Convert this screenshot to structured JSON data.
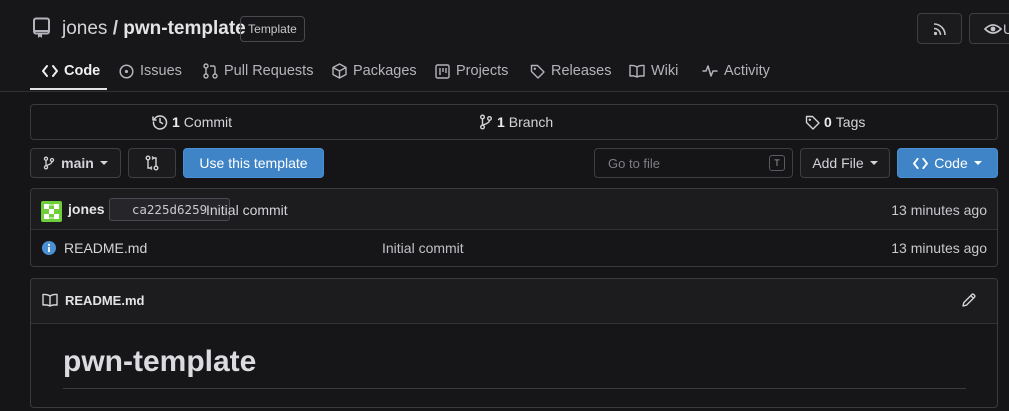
{
  "repo": {
    "owner": "jones",
    "separator": "/",
    "name": "pwn-template",
    "badge": "Template"
  },
  "header_actions": {
    "rss_icon": "rss-icon",
    "watch_icon": "eye-icon",
    "watch_label_partial": "U"
  },
  "tabs": [
    {
      "label": "Code",
      "icon": "code-icon",
      "active": true
    },
    {
      "label": "Issues",
      "icon": "issue-icon"
    },
    {
      "label": "Pull Requests",
      "icon": "pull-request-icon"
    },
    {
      "label": "Packages",
      "icon": "package-icon"
    },
    {
      "label": "Projects",
      "icon": "project-icon"
    },
    {
      "label": "Releases",
      "icon": "tag-icon"
    },
    {
      "label": "Wiki",
      "icon": "book-icon"
    },
    {
      "label": "Activity",
      "icon": "pulse-icon"
    }
  ],
  "stats": {
    "commits_count": "1",
    "commits_label": "Commit",
    "branches_count": "1",
    "branches_label": "Branch",
    "tags_count": "0",
    "tags_label": "Tags"
  },
  "toolbar": {
    "branch": "main",
    "use_template_label": "Use this template",
    "goto_placeholder": "Go to file",
    "goto_shortcut": "T",
    "add_file_label": "Add File",
    "code_label": "Code"
  },
  "latest_commit": {
    "author": "jones",
    "sha": "ca225d6259",
    "message": "Initial commit",
    "time": "13 minutes ago"
  },
  "files": [
    {
      "name": "README.md",
      "commit_message": "Initial commit",
      "time": "13 minutes ago"
    }
  ],
  "readme": {
    "file_label": "README.md",
    "heading": "pwn-template"
  },
  "colors": {
    "primary": "#3f84c6",
    "background": "#151518",
    "info": "#4a90d2"
  }
}
